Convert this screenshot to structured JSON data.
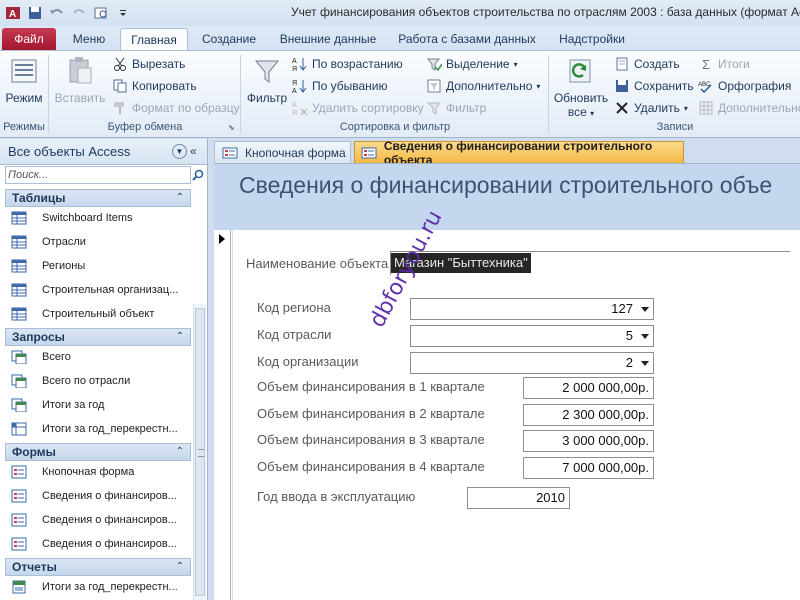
{
  "window": {
    "title": "Учет финансирования объектов строительства по отраслям 2003 : база данных (формат Acc"
  },
  "ribbon_tabs": [
    "Файл",
    "Меню",
    "Главная",
    "Создание",
    "Внешние данные",
    "Работа с базами данных",
    "Надстройки"
  ],
  "ribbon": {
    "views": {
      "mode": "Режим",
      "group": "Режимы"
    },
    "clipboard": {
      "paste": "Вставить",
      "cut": "Вырезать",
      "copy": "Копировать",
      "format_painter": "Формат по образцу",
      "group": "Буфер обмена"
    },
    "sort_filter": {
      "filter": "Фильтр",
      "ascending": "По возрастанию",
      "descending": "По убыванию",
      "remove_sort": "Удалить сортировку",
      "selection": "Выделение",
      "advanced": "Дополнительно",
      "toggle_filter": "Фильтр",
      "group": "Сортировка и фильтр"
    },
    "records": {
      "refresh_all": "Обновить",
      "refresh_all_2": "все",
      "new": "Создать",
      "save": "Сохранить",
      "delete": "Удалить",
      "totals": "Итоги",
      "spelling": "Орфография",
      "more": "Дополнительно",
      "group": "Записи"
    }
  },
  "nav": {
    "title": "Все объекты Access",
    "search_placeholder": "Поиск...",
    "sections": [
      {
        "label": "Таблицы",
        "items": [
          "Switchboard Items",
          "Отрасли",
          "Регионы",
          "Строительная организац...",
          "Строительный объект"
        ]
      },
      {
        "label": "Запросы",
        "items": [
          "Всего",
          "Всего по отрасли",
          "Итоги за год",
          "Итоги за год_перекрестн..."
        ]
      },
      {
        "label": "Формы",
        "items": [
          "Кнопочная форма",
          "Сведения о финансиров...",
          "Сведения о финансиров...",
          "Сведения о финансиров..."
        ]
      },
      {
        "label": "Отчеты",
        "items": [
          "Итоги за год_перекрестн..."
        ]
      }
    ]
  },
  "doc_tabs": [
    "Кнопочная форма",
    "Сведения о финансировании строительного объекта"
  ],
  "form": {
    "title": "Сведения о финансировании строительного объе",
    "fields": {
      "name_label": "Наименование объекта",
      "name_value": "Магазин \"Быттехника\"",
      "region_label": "Код региона",
      "region_value": "127",
      "industry_label": "Код отрасли",
      "industry_value": "5",
      "org_label": "Код организации",
      "org_value": "2",
      "q1_label": "Объем финансирования в 1 квартале",
      "q1_value": "2 000 000,00р.",
      "q2_label": "Объем финансирования в 2 квартале",
      "q2_value": "2 300 000,00р.",
      "q3_label": "Объем финансирования в 3 квартале",
      "q3_value": "3 000 000,00р.",
      "q4_label": "Объем финансирования в 4 квартале",
      "q4_value": "7 000 000,00р.",
      "year_label": "Год ввода в эксплуатацию",
      "year_value": "2010"
    }
  },
  "watermark": "dbforyou.ru",
  "colors": {
    "file_tab": "#b62740",
    "active_doc_tab": "#f6b945",
    "form_header": "#c5d7ee"
  }
}
